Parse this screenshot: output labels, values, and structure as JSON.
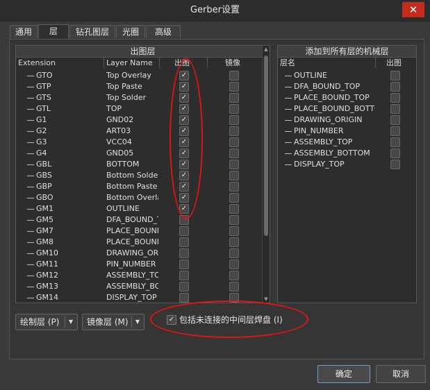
{
  "window": {
    "title": "Gerber设置",
    "close_glyph": "✕"
  },
  "tabs": [
    {
      "label": "通用",
      "active": false
    },
    {
      "label": "层",
      "active": true
    },
    {
      "label": "钻孔图层",
      "active": false
    },
    {
      "label": "光圈",
      "active": false
    },
    {
      "label": "高级",
      "active": false
    }
  ],
  "plot_panel": {
    "title": "出图层",
    "columns": {
      "extension": "Extension",
      "layer_name": "Layer Name",
      "plot": "出图",
      "mirror": "镜像"
    },
    "rows": [
      {
        "ext": "GTO",
        "name": "Top Overlay",
        "plot": true,
        "mirror": false
      },
      {
        "ext": "GTP",
        "name": "Top Paste",
        "plot": true,
        "mirror": false
      },
      {
        "ext": "GTS",
        "name": "Top Solder",
        "plot": true,
        "mirror": false
      },
      {
        "ext": "GTL",
        "name": "TOP",
        "plot": true,
        "mirror": false
      },
      {
        "ext": "G1",
        "name": "GND02",
        "plot": true,
        "mirror": false
      },
      {
        "ext": "G2",
        "name": "ART03",
        "plot": true,
        "mirror": false
      },
      {
        "ext": "G3",
        "name": "VCC04",
        "plot": true,
        "mirror": false
      },
      {
        "ext": "G4",
        "name": "GND05",
        "plot": true,
        "mirror": false
      },
      {
        "ext": "GBL",
        "name": "BOTTOM",
        "plot": true,
        "mirror": false
      },
      {
        "ext": "GBS",
        "name": "Bottom Solder",
        "plot": true,
        "mirror": false
      },
      {
        "ext": "GBP",
        "name": "Bottom Paste",
        "plot": true,
        "mirror": false
      },
      {
        "ext": "GBO",
        "name": "Bottom Overlay",
        "plot": true,
        "mirror": false
      },
      {
        "ext": "GM1",
        "name": "OUTLINE",
        "plot": true,
        "mirror": false
      },
      {
        "ext": "GM5",
        "name": "DFA_BOUND_TOP",
        "plot": false,
        "mirror": false
      },
      {
        "ext": "GM7",
        "name": "PLACE_BOUND_TOP",
        "plot": false,
        "mirror": false
      },
      {
        "ext": "GM8",
        "name": "PLACE_BOUND_BOTTOM",
        "plot": false,
        "mirror": false
      },
      {
        "ext": "GM10",
        "name": "DRAWING_ORIGIN",
        "plot": false,
        "mirror": false
      },
      {
        "ext": "GM11",
        "name": "PIN_NUMBER",
        "plot": false,
        "mirror": false
      },
      {
        "ext": "GM12",
        "name": "ASSEMBLY_TOP",
        "plot": false,
        "mirror": false
      },
      {
        "ext": "GM13",
        "name": "ASSEMBLY_BOTTOM",
        "plot": false,
        "mirror": false
      },
      {
        "ext": "GM14",
        "name": "DISPLAY_TOP",
        "plot": false,
        "mirror": false
      }
    ]
  },
  "mech_panel": {
    "title": "添加到所有层的机械层",
    "columns": {
      "layer_name": "层名",
      "plot": "出图"
    },
    "rows": [
      {
        "name": "OUTLINE",
        "plot": false
      },
      {
        "name": "DFA_BOUND_TOP",
        "plot": false
      },
      {
        "name": "PLACE_BOUND_TOP",
        "plot": false
      },
      {
        "name": "PLACE_BOUND_BOTTOM",
        "plot": false
      },
      {
        "name": "DRAWING_ORIGIN",
        "plot": false
      },
      {
        "name": "PIN_NUMBER",
        "plot": false
      },
      {
        "name": "ASSEMBLY_TOP",
        "plot": false
      },
      {
        "name": "ASSEMBLY_BOTTOM",
        "plot": false
      },
      {
        "name": "DISPLAY_TOP",
        "plot": false
      }
    ]
  },
  "buttons": {
    "plot_layers": "绘制层 (P)",
    "mirror_layers": "镜像层 (M)",
    "include_unconnected": "包括未连接的中间层焊盘 (I)",
    "include_unconnected_checked": true,
    "ok": "确定",
    "cancel": "取消"
  },
  "colors": {
    "highlight_ellipse": "#e01515",
    "ok_border": "#7a9ad8",
    "close_bg": "#c42b1c"
  }
}
